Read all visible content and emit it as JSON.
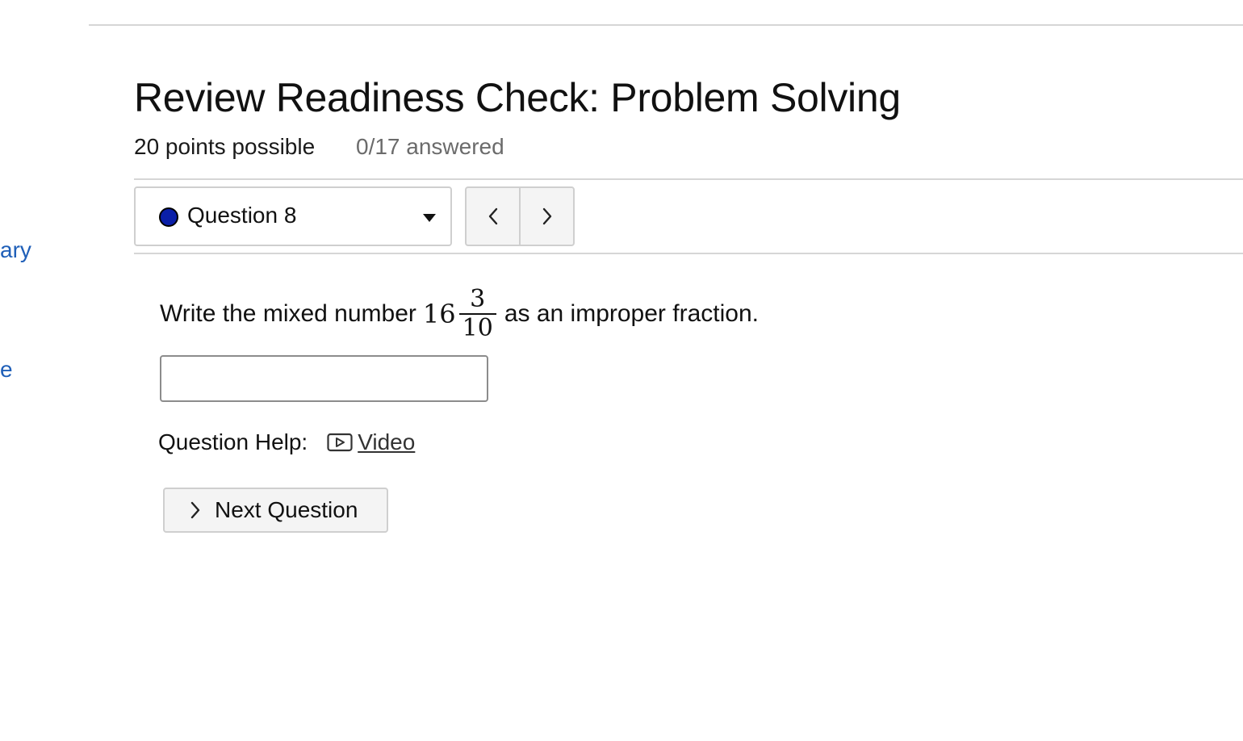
{
  "sidebar": {
    "link_fragment_1": "ary",
    "link_fragment_2": "e"
  },
  "assessment": {
    "title": "Review Readiness Check: Problem Solving",
    "points_possible": "20 points possible",
    "answered": "0/17 answered"
  },
  "question_selector": {
    "selected": "Question 8",
    "status_color": "#0a1fa8"
  },
  "question": {
    "prefix": "Write the mixed number",
    "whole": "16",
    "numerator": "3",
    "denominator": "10",
    "suffix": "as an improper fraction.",
    "answer_value": "",
    "answer_placeholder": ""
  },
  "help": {
    "label": "Question Help:",
    "video_label": "Video",
    "video_icon": "play-video-icon"
  },
  "actions": {
    "next_question_label": "Next Question",
    "prev_icon": "chevron-left-icon",
    "next_icon": "chevron-right-icon"
  },
  "colors": {
    "link": "#1f5fb8",
    "muted_text": "#6b6b6b",
    "border": "#cfcfcf"
  }
}
